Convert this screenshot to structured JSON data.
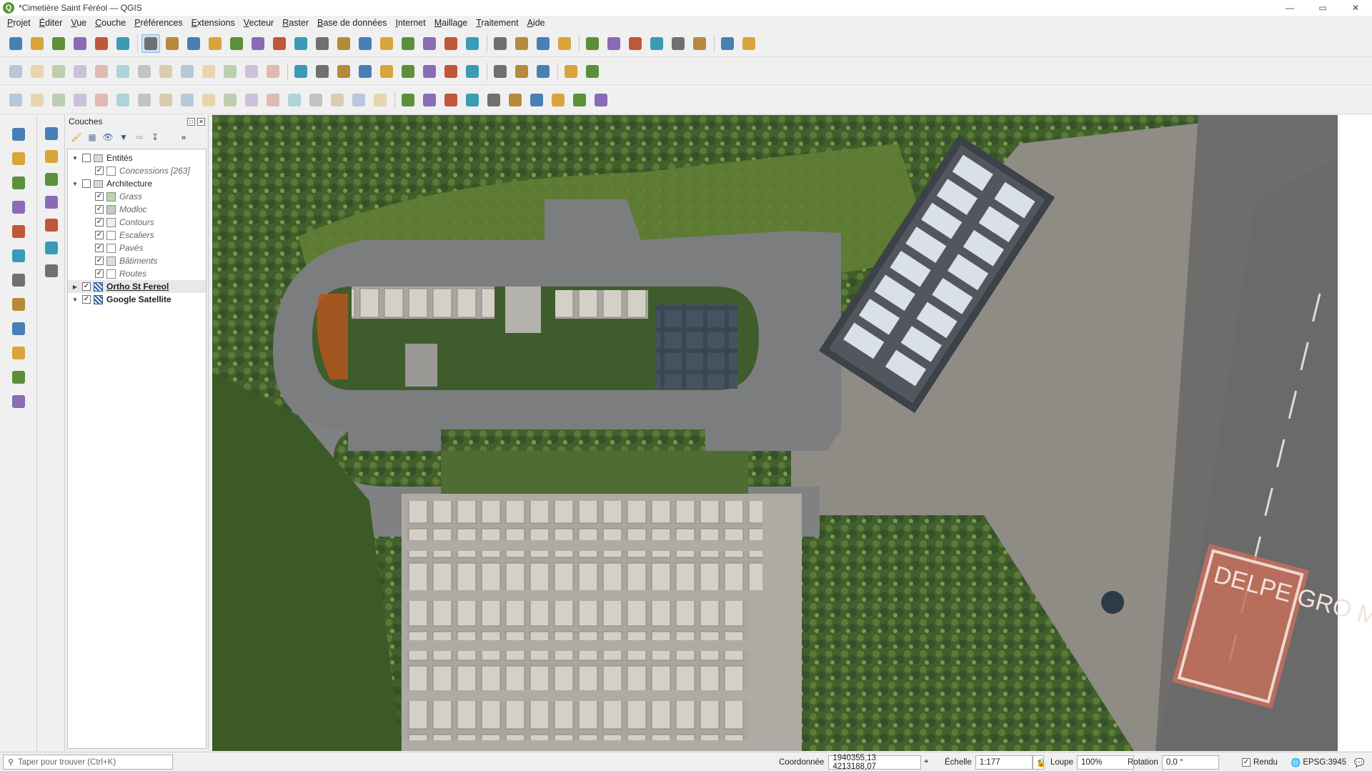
{
  "window": {
    "title": "*Cimetière Saint Féréol — QGIS"
  },
  "menu": [
    "Projet",
    "Éditer",
    "Vue",
    "Couche",
    "Préférences",
    "Extensions",
    "Vecteur",
    "Raster",
    "Base de données",
    "Internet",
    "Maillage",
    "Traitement",
    "Aide"
  ],
  "toolbar": {
    "row1_icons": [
      "new-project-icon",
      "open-project-icon",
      "save-project-icon",
      "save-as-icon",
      "print-layout-icon",
      "style-manager-icon",
      "pan-icon",
      "pan-to-selection-icon",
      "zoom-in-icon",
      "zoom-out-icon",
      "zoom-full-icon",
      "zoom-to-selection-icon",
      "zoom-to-layer-icon",
      "zoom-native-icon",
      "zoom-last-icon",
      "zoom-next-icon",
      "new-map-view-icon",
      "new-3d-view-icon",
      "new-bookmark-icon",
      "show-bookmarks-icon",
      "temporal-controller-icon",
      "refresh-icon",
      "select-features-icon",
      "select-by-value-icon",
      "deselect-icon",
      "select-location-icon",
      "identify-icon",
      "attribute-table-icon",
      "toolbox-icon",
      "statistics-icon",
      "field-calculator-icon",
      "measure-icon",
      "map-tips-icon",
      "annotation-icon"
    ],
    "row2_icons": [
      "current-edits-icon",
      "toggle-editing-icon",
      "save-edits-icon",
      "digitize-icon",
      "add-feature-icon",
      "vertex-tool-icon",
      "modify-attributes-icon",
      "delete-selected-icon",
      "cut-features-icon",
      "copy-features-icon",
      "paste-features-icon",
      "undo-icon",
      "redo-icon",
      "label-toolbar-icon",
      "label-tool-icon",
      "layer-labeling-icon",
      "pin-labels-icon",
      "show-hide-labels-icon",
      "move-label-icon",
      "rotate-label-icon",
      "change-label-icon",
      "label-props-icon",
      "metasearch-icon",
      "wms-icon",
      "wfs-icon",
      "python-console-icon",
      "help-icon"
    ],
    "row3_icons": [
      "advanced-digitizing-icon",
      "move-feature-icon",
      "rotate-feature-icon",
      "simplify-icon",
      "add-ring-icon",
      "add-part-icon",
      "fill-ring-icon",
      "delete-ring-icon",
      "delete-part-icon",
      "reshape-icon",
      "offset-curve-icon",
      "split-features-icon",
      "split-parts-icon",
      "merge-features-icon",
      "merge-attributes-icon",
      "rotate-symbol-icon",
      "reverse-line-icon",
      "trim-extend-icon",
      "raster-stretch-icon",
      "raster-histogram-icon",
      "raster-cumulative-icon",
      "raster-local-icon",
      "increase-brightness-icon",
      "decrease-brightness-icon",
      "increase-contrast-icon",
      "decrease-contrast-icon",
      "increase-gamma-icon",
      "decrease-gamma-icon"
    ],
    "left_icons": [
      "new-vector-layer-icon",
      "add-raster-icon",
      "add-vector-icon",
      "add-delimited-text-icon",
      "add-spatialite-icon",
      "add-postgis-icon",
      "add-virtual-layer-icon",
      "add-wms-icon",
      "add-wfs-icon",
      "add-wcs-icon",
      "add-mesh-icon",
      "create-layer-icon"
    ],
    "left2_icons": [
      "data-source-manager-icon",
      "new-geopackage-icon",
      "new-shapefile-icon",
      "new-spatialite-icon",
      "new-temp-layer-icon",
      "add-xyz-icon",
      "add-vector-tile-icon"
    ]
  },
  "layers_panel": {
    "title": "Couches",
    "tree": [
      {
        "label": "Entités",
        "type": "group",
        "checked": false,
        "expanded": true,
        "depth": 0
      },
      {
        "label": "Concessions [263]",
        "type": "vector",
        "checked": true,
        "style": "italic",
        "swatch": "#ffffff",
        "depth": 1
      },
      {
        "label": "Architecture",
        "type": "group",
        "checked": false,
        "expanded": true,
        "depth": 0
      },
      {
        "label": "Grass",
        "type": "vector",
        "checked": true,
        "style": "italic",
        "swatch": "#b8d8a8",
        "depth": 1
      },
      {
        "label": "Modloc",
        "type": "vector",
        "checked": true,
        "style": "italic",
        "swatch": "#c8c8c8",
        "depth": 1
      },
      {
        "label": "Contours",
        "type": "vector",
        "checked": true,
        "style": "italic",
        "swatch": "#eeeeee",
        "depth": 1
      },
      {
        "label": "Escaliers",
        "type": "vector",
        "checked": true,
        "style": "italic",
        "swatch": "#ffffff",
        "depth": 1
      },
      {
        "label": "Pavés",
        "type": "vector",
        "checked": true,
        "style": "italic",
        "swatch": "#ffffff",
        "depth": 1
      },
      {
        "label": "Bâtiments",
        "type": "vector",
        "checked": true,
        "style": "italic",
        "swatch": "#dddddd",
        "depth": 1
      },
      {
        "label": "Routes",
        "type": "vector",
        "checked": true,
        "style": "italic",
        "swatch": "#ffffff",
        "depth": 1
      },
      {
        "label": "Ortho St Fereol",
        "type": "raster",
        "checked": true,
        "style": "bold-underline",
        "expanded": false,
        "depth": 0
      },
      {
        "label": "Google Satellite",
        "type": "raster",
        "checked": true,
        "style": "bold",
        "expanded": true,
        "depth": 0
      }
    ]
  },
  "statusbar": {
    "locator_placeholder": "Taper pour trouver (Ctrl+K)",
    "coord_label": "Coordonnée",
    "coord_value": "1940355,13  4213188,07",
    "scale_label": "Échelle",
    "scale_value": "1:177",
    "magnifier_label": "Loupe",
    "magnifier_value": "100%",
    "rotation_label": "Rotation",
    "rotation_value": "0,0 °",
    "render_label": "Rendu",
    "crs": "EPSG:3945"
  },
  "map_overlay": {
    "road_text": "DELPE GRO MY"
  },
  "colors": {
    "accent": "#589632",
    "selection": "#cde1f5",
    "grass": "#4a6a2f",
    "asphalt": "#7a7b7c"
  }
}
